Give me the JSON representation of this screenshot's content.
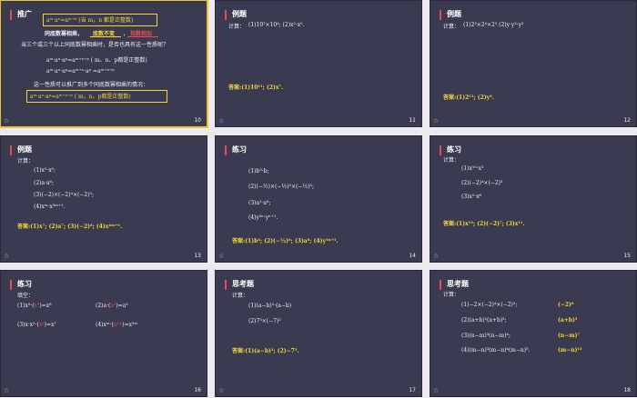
{
  "slides": [
    {
      "number": "10",
      "title": "推广",
      "lines": {
        "formula1": "aᵐ·aⁿ=aᵐ⁺ⁿ (当 m，n 都是正整数)",
        "rule_a": "同底数幂相乘，",
        "rule_b": "底数不变",
        "rule_c": "，",
        "rule_d": "指数相加",
        "question": "当三个或三个以上同底数幂相乘时，是否也具有这一性质呢？",
        "eq1": "aᵐ·aⁿ·aᵖ=aᵐ⁺ⁿ⁺ᵖ  ( m、n、p都是正整数)",
        "eq2": "aᵐ·aⁿ·aᵖ=aᵐ⁺ⁿ·aᵖ   =aᵐ⁺ⁿ⁺ᵖ",
        "extend": "这一性质可以推广到多个同底数幂相乘的情况：",
        "final": "aᵐ·aⁿ·aᵖ=aᵐ⁺ⁿ⁺ᵖ  ( m，n，p都是正整数)"
      }
    },
    {
      "number": "11",
      "title": "例题",
      "lines": {
        "calc": "计算：",
        "q": "(1)10⁷×10⁴;          (2)x²·x⁵.",
        "answer": "答案:(1)10¹¹;   (2)x⁷."
      }
    },
    {
      "number": "12",
      "title": "例题",
      "lines": {
        "calc": "计算：",
        "q": "(1)2³×2⁴×2⁵          (2)y·y²·y³",
        "answer": "答案:(1)2¹²;     (2)y⁶."
      }
    },
    {
      "number": "13",
      "title": "例题",
      "lines": {
        "calc": "计算：",
        "q1": "(1)x²·x⁵;",
        "q2": "(2)a·a⁶;",
        "q3": "(3)(−2)×(−2)⁴×(−2)³;",
        "q4": "(4)xᵐ·x³ᵐ⁺¹.",
        "answer": "答案:(1)x⁷;     (2)a⁷;     (3)(−2)⁸;     (4)x⁴ᵐ⁺¹."
      }
    },
    {
      "number": "14",
      "title": "练习",
      "lines": {
        "q1": "(1)b³·b;",
        "q2": "(2)(−½)×(−½)²×(−½)³;",
        "q3": "(3)a²·a⁶;",
        "q4": "(4)y²ⁿ·yⁿ⁺¹.",
        "answer": "答案:(1)b⁴;     (2)(−½)⁶;     (3)a⁸;     (4)y³ⁿ⁺¹."
      }
    },
    {
      "number": "15",
      "title": "练习",
      "lines": {
        "calc": "计算：",
        "q1": "(1)x¹⁰·x³",
        "q2": "(2)(−2)⁴×(−2)³",
        "q3": "(3)x⁵·x⁶",
        "answer": "答案:(1)x¹³;     (2)(−2)⁷;     (3)x¹¹."
      }
    },
    {
      "number": "16",
      "title": "练习",
      "lines": {
        "fill": "填空：",
        "q1a": "(1)x⁵·(",
        "q1b": "x³",
        "q1c": ")=x⁸",
        "q2a": "(2)a·(",
        "q2b": "a²",
        "q2c": ")=a³",
        "q3a": "(3)x·x²·(",
        "q3b": "x⁴",
        "q3c": ")=x⁷",
        "q4a": "(4)xᵐ·(",
        "q4b": "x²ᵐ",
        "q4c": ")=x³ᵐ"
      }
    },
    {
      "number": "17",
      "title": "思考题",
      "lines": {
        "calc": "计算：",
        "q1": "(1)(a−b)²·(a−b)",
        "q2": "(2)7³×(−7)²",
        "answer": "答案:(1)(a−b)³;     (2)−7⁵."
      }
    },
    {
      "number": "18",
      "title": "思考题",
      "lines": {
        "calc": "计算：",
        "q1": "(1)−2×(−2)⁴×(−2)³;",
        "a1": "(−2)⁸",
        "q2": "(2)(a+b)²(a+b)³;",
        "a2": "(a+b)⁵",
        "q3": "(3)(n−m)³(n−m)⁴;",
        "a3": "(n−m)⁷",
        "q4": "(4)(m−n)³(m−n)⁴(m−n)⁵.",
        "a4": "(m−n)¹²"
      }
    }
  ],
  "icons": {
    "star": "☆"
  },
  "colors": {
    "slide_bg": "#3a3b50",
    "accent_bar": "#e64a5a",
    "answer": "#f3d53a",
    "selection": "#f2c12e"
  }
}
